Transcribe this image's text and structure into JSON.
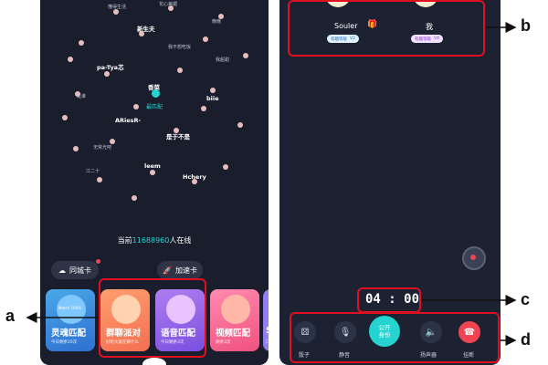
{
  "left_screen": {
    "planet_names": [
      "懂得生活",
      "花心美媚",
      "新生夫",
      "晚晚",
      "我不想吃饭",
      "pa-Tya芯",
      "我超甜",
      "是谁",
      "香菜",
      "ARiesR-",
      "是于不是",
      "无常光吧",
      "leem",
      "Hchery",
      "江二十",
      "biie"
    ],
    "center_label": "最匹配",
    "online_prefix": "当前",
    "online_count": "11688960",
    "online_suffix": "人在线",
    "pill_city": "同城卡",
    "pill_speed": "加速卡",
    "cards": [
      {
        "title": "灵魂匹配",
        "sub": "今日剩余20次"
      },
      {
        "title": "群聊派对",
        "sub": "好听大家在聊什么"
      },
      {
        "title": "语音匹配",
        "sub": "今日剩余3次"
      },
      {
        "title": "视频匹配",
        "sub": "剩余3次"
      },
      {
        "title": "So",
        "sub": "口"
      }
    ],
    "card_badge": "Match 100%"
  },
  "right_screen": {
    "user1_name": "Souler",
    "user1_level": "有趣等级",
    "user1_v": "V2",
    "user2_name": "我",
    "user2_level": "有趣等级",
    "user2_v": "V4",
    "timer": "04 : 00",
    "controls": [
      {
        "label": "骰子",
        "icon": "dice-icon"
      },
      {
        "label": "静音",
        "icon": "mute-mic-icon"
      },
      {
        "label": "公开\n身份",
        "icon": "reveal-identity"
      },
      {
        "label": "扬声器",
        "icon": "speaker-icon"
      },
      {
        "label": "挂断",
        "icon": "hangup-icon"
      }
    ]
  },
  "annotations": {
    "a": "a",
    "b": "b",
    "c": "c",
    "d": "d"
  },
  "colors": {
    "accent": "#25d4d0",
    "annotation_red": "#e01020",
    "hangup": "#f04452"
  }
}
